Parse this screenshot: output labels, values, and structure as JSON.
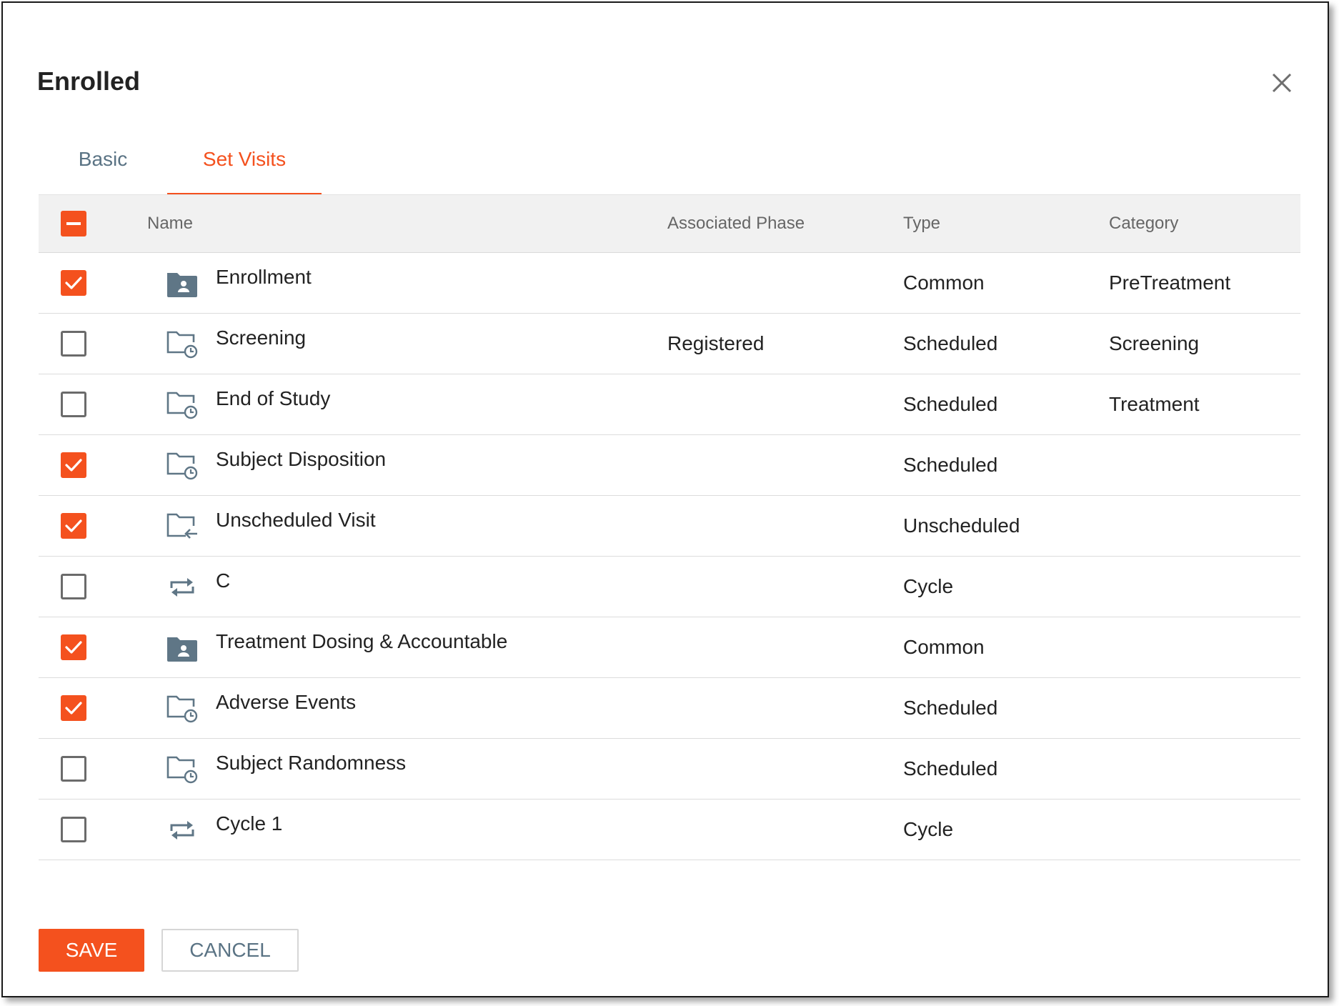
{
  "dialog": {
    "title": "Enrolled",
    "close_icon": "close-icon"
  },
  "tabs": [
    {
      "label": "Basic",
      "active": false
    },
    {
      "label": "Set Visits",
      "active": true
    }
  ],
  "table": {
    "header_checkbox_state": "indeterminate",
    "columns": {
      "name": "Name",
      "phase": "Associated Phase",
      "type": "Type",
      "category": "Category"
    },
    "rows": [
      {
        "checked": true,
        "icon": "folder-person-icon",
        "name": "Enrollment",
        "phase": "",
        "type": "Common",
        "category": "PreTreatment"
      },
      {
        "checked": false,
        "icon": "folder-clock-icon",
        "name": "Screening",
        "phase": "Registered",
        "type": "Scheduled",
        "category": "Screening"
      },
      {
        "checked": false,
        "icon": "folder-clock-icon",
        "name": "End of Study",
        "phase": "",
        "type": "Scheduled",
        "category": "Treatment"
      },
      {
        "checked": true,
        "icon": "folder-clock-icon",
        "name": "Subject Disposition",
        "phase": "",
        "type": "Scheduled",
        "category": ""
      },
      {
        "checked": true,
        "icon": "folder-arrow-icon",
        "name": "Unscheduled Visit",
        "phase": "",
        "type": "Unscheduled",
        "category": ""
      },
      {
        "checked": false,
        "icon": "repeat-icon",
        "name": "C",
        "phase": "",
        "type": "Cycle",
        "category": ""
      },
      {
        "checked": true,
        "icon": "folder-person-icon",
        "name": "Treatment Dosing & Accountable",
        "phase": "",
        "type": "Common",
        "category": ""
      },
      {
        "checked": true,
        "icon": "folder-clock-icon",
        "name": "Adverse Events",
        "phase": "",
        "type": "Scheduled",
        "category": ""
      },
      {
        "checked": false,
        "icon": "folder-clock-icon",
        "name": "Subject Randomness",
        "phase": "",
        "type": "Scheduled",
        "category": ""
      },
      {
        "checked": false,
        "icon": "repeat-icon",
        "name": "Cycle 1",
        "phase": "",
        "type": "Cycle",
        "category": ""
      }
    ]
  },
  "buttons": {
    "save": "SAVE",
    "cancel": "CANCEL"
  },
  "colors": {
    "accent": "#f4511e",
    "muted_blue": "#5a7384",
    "icon_slate": "#5f7686"
  }
}
